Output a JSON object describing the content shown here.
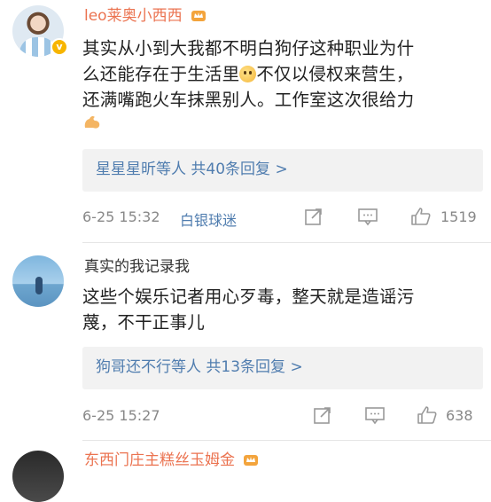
{
  "comments": [
    {
      "username": "leo莱奥小西西",
      "content_lines": [
        "其实从小到大我都不明白狗仔这种职业为什",
        "么还能存在于生活里",
        "不仅以侵权来营生，",
        "还满嘴跑火车抹黑别人。工作室这次很给力"
      ],
      "emoji_inline": "thinking-emoji",
      "emoji_trailing": "strong-arm-emoji",
      "replies_text": "星星星昕等人 共40条回复 >",
      "time": "6-25 15:32",
      "source": "白银球迷",
      "likes": "1519"
    },
    {
      "username": "真实的我记录我",
      "content_lines": [
        "这些个娱乐记者用心歹毒，整天就是造谣污",
        "蔑，不干正事儿"
      ],
      "replies_text": "狗哥还不行等人 共13条回复 >",
      "time": "6-25 15:27",
      "likes": "638"
    },
    {
      "username": "东西门庄主糕丝玉姆金"
    }
  ],
  "colors": {
    "username_accent": "#eb7350",
    "link": "#507daf",
    "meta": "#888888",
    "reply_bg": "#f2f2f2",
    "vip_badge": "#f7b500"
  }
}
